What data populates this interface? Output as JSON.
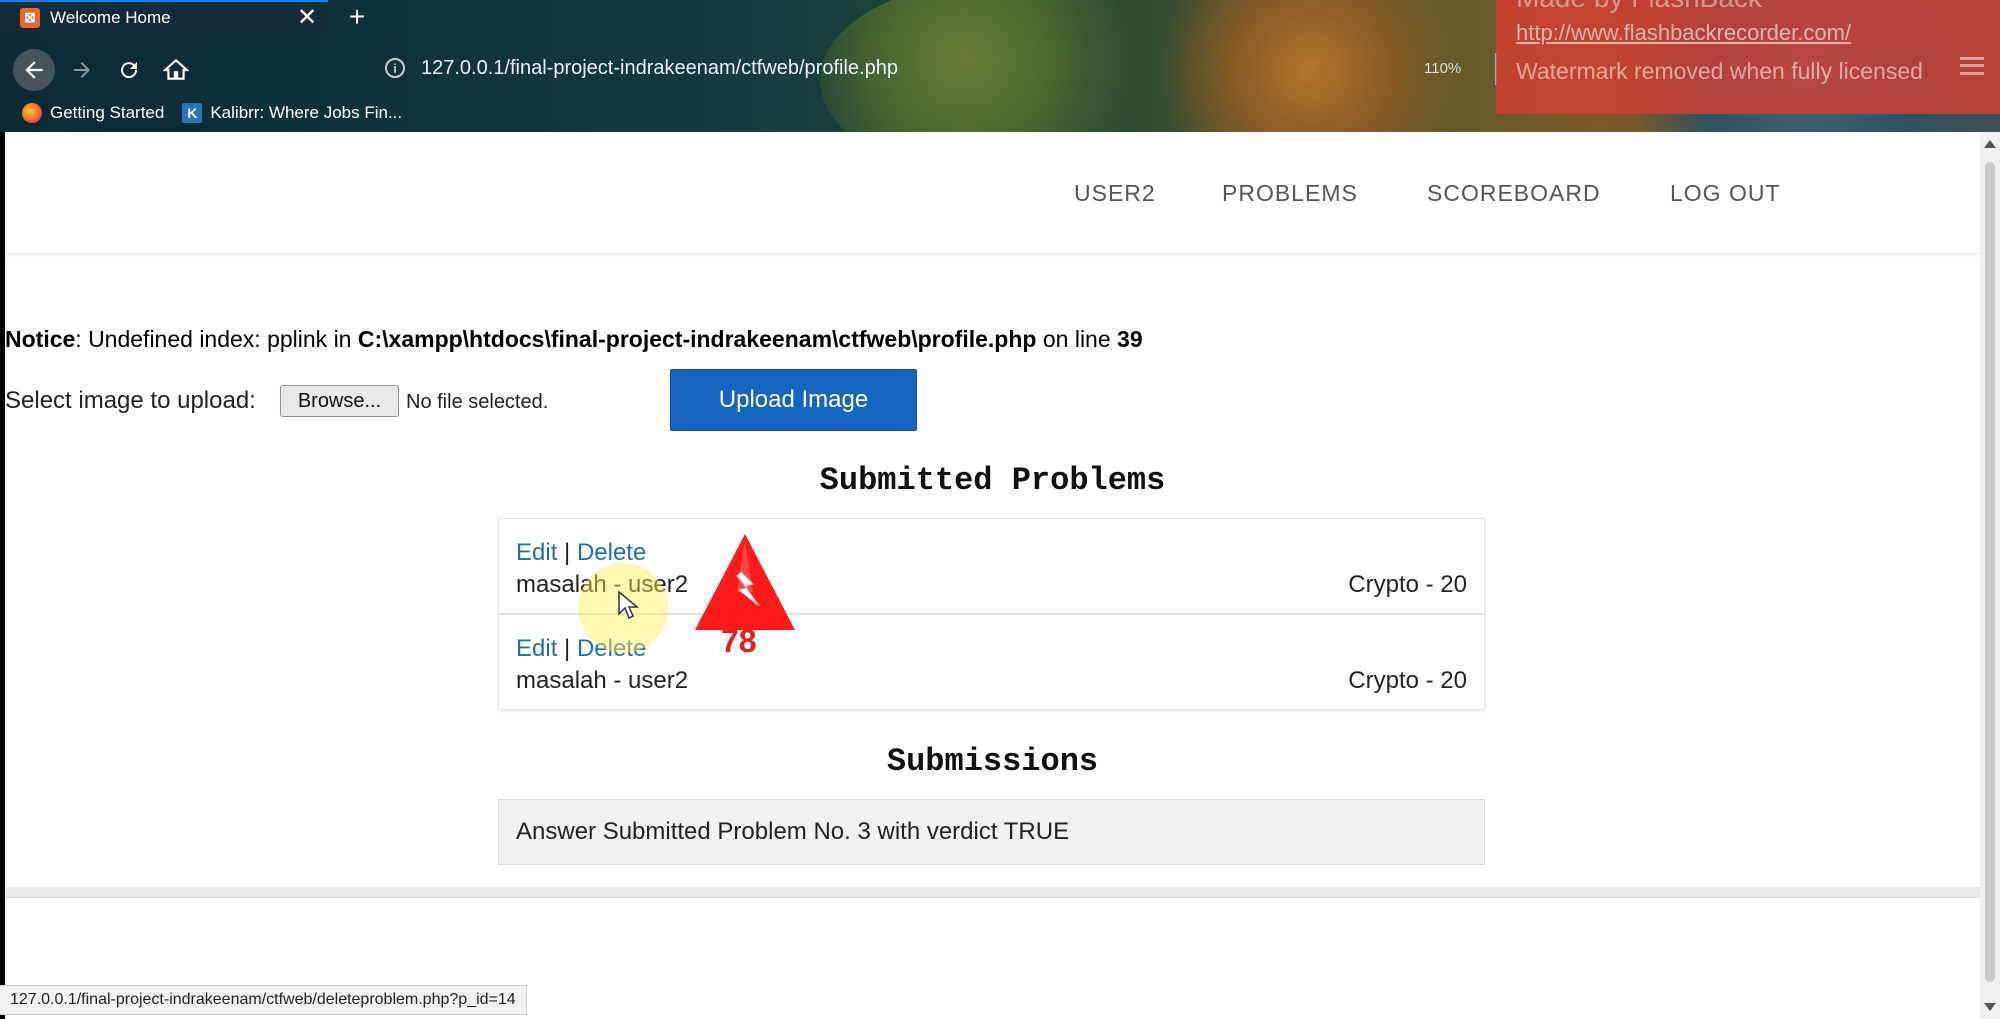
{
  "browser": {
    "tab_title": "Welcome Home",
    "tab_close": "✕",
    "new_tab": "+",
    "url": "127.0.0.1/final-project-indrakeenam/ctfweb/profile.php",
    "zoom": "110%",
    "bookmarks": [
      {
        "label": "Getting Started",
        "icon": "firefox-icon"
      },
      {
        "label": "Kalibrr: Where Jobs Fin...",
        "icon": "kalibrr-icon"
      }
    ],
    "status_url": "127.0.0.1/final-project-indrakeenam/ctfweb/deleteproblem.php?p_id=14"
  },
  "watermark": {
    "header": "Made by FlashBack",
    "url": "http://www.flashbackrecorder.com/",
    "note": "Watermark removed when fully licensed"
  },
  "nav": {
    "user": "USER2",
    "problems": "PROBLEMS",
    "scoreboard": "SCOREBOARD",
    "logout": "LOG OUT"
  },
  "notice": {
    "label": "Notice",
    "message": ": Undefined index: pplink in ",
    "path": "C:\\xampp\\htdocs\\final-project-indrakeenam\\ctfweb\\profile.php",
    "on_line": " on line ",
    "line": "39"
  },
  "upload": {
    "label": "Select image to upload:",
    "browse": "Browse...",
    "no_file": "No file selected.",
    "button": "Upload Image"
  },
  "submitted_problems": {
    "title": "Submitted Problems",
    "items": [
      {
        "edit": "Edit",
        "sep": " | ",
        "delete": "Delete",
        "name": "masalah - user2",
        "category": "Crypto - 20"
      },
      {
        "edit": "Edit",
        "sep": " | ",
        "delete": "Delete",
        "name": "masalah - user2",
        "category": "Crypto - 20"
      }
    ]
  },
  "submissions": {
    "title": "Submissions",
    "items": [
      "Answer Submitted Problem No. 3 with verdict TRUE"
    ]
  },
  "overlay": {
    "badge_number": "78",
    "badge_color": "#e0201a"
  }
}
